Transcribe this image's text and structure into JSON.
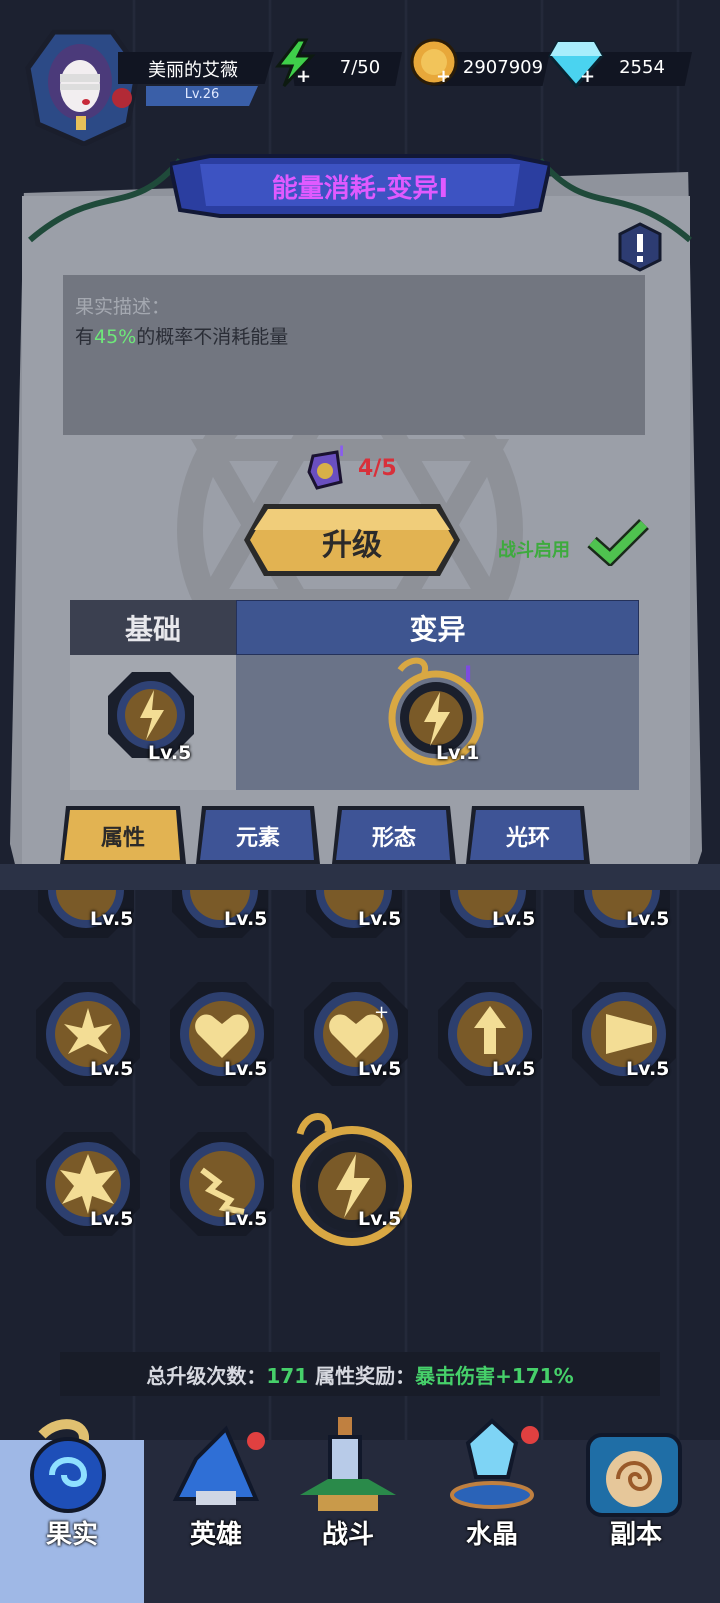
{
  "player": {
    "name": "美丽的艾薇",
    "level": "Lv.26"
  },
  "resources": {
    "energy": "7/50",
    "gold": "2907909",
    "diamond": "2554"
  },
  "panel": {
    "title": "能量消耗-变异I",
    "desc_label": "果实描述：",
    "desc_prefix": "有",
    "desc_highlight": "45%",
    "desc_suffix": "的概率不消耗能量",
    "fragment_count": "4/5",
    "upgrade_label": "升级",
    "battle_enable_label": "战斗启用",
    "base_header": "基础",
    "mutation_header": "变异",
    "base_level": "Lv.5",
    "mutation_level": "Lv.1"
  },
  "tabs": [
    "属性",
    "元素",
    "形态",
    "光环"
  ],
  "grid": {
    "row1": [
      "Lv.5",
      "Lv.5",
      "Lv.5",
      "Lv.5",
      "Lv.5"
    ],
    "row2": [
      "Lv.5",
      "Lv.5",
      "Lv.5",
      "Lv.5",
      "Lv.5"
    ],
    "row3": [
      "Lv.5",
      "Lv.5",
      "Lv.5"
    ]
  },
  "summary": {
    "upgrades_label": "总升级次数：",
    "upgrades_value": "171",
    "bonus_label": "属性奖励：",
    "bonus_value": "暴击伤害+171%"
  },
  "nav": [
    "果实",
    "英雄",
    "战斗",
    "水晶",
    "副本"
  ],
  "colors": {
    "mutation_purple": "#e05aff",
    "highlight_green": "#6ee87a",
    "fragment_red": "#d8303a",
    "gold": "#e2b352",
    "blue_banner": "#3e5590"
  }
}
